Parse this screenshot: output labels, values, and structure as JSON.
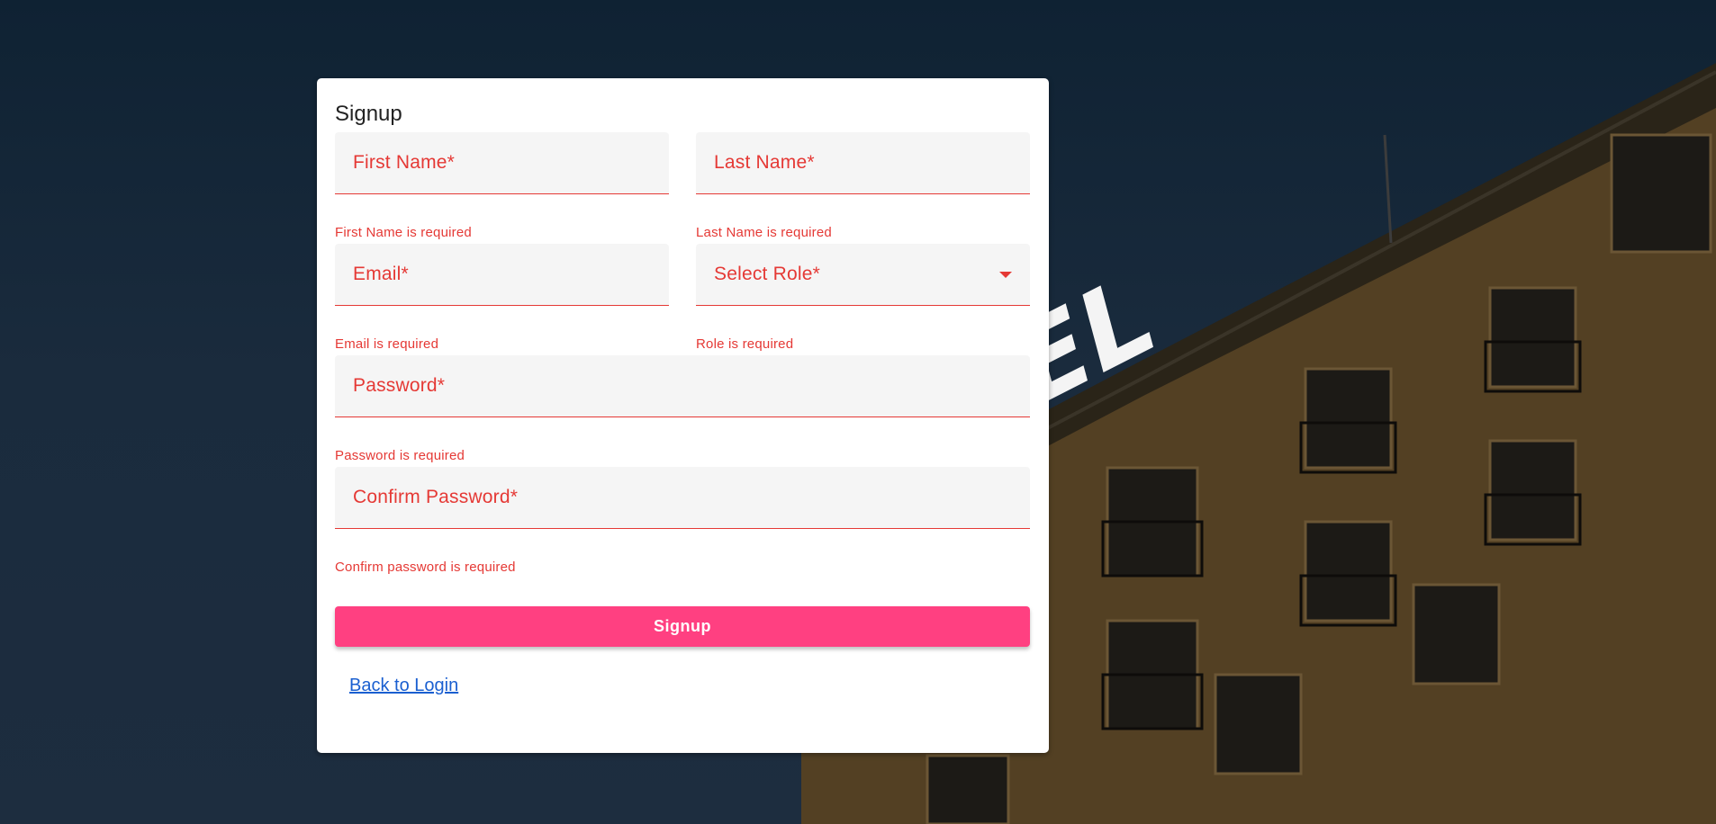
{
  "form": {
    "title": "Signup",
    "first_name": {
      "label": "First Name*",
      "error": "First Name is required"
    },
    "last_name": {
      "label": "Last Name*",
      "error": "Last Name is required"
    },
    "email": {
      "label": "Email*",
      "error": "Email is required"
    },
    "role": {
      "label": "Select Role*",
      "error": "Role is required",
      "icon": "dropdown-arrow-icon"
    },
    "password": {
      "label": "Password*",
      "error": "Password is required"
    },
    "confirm_password": {
      "label": "Confirm Password*",
      "error": "Confirm password is required"
    },
    "submit_label": "Signup",
    "back_link": "Back to Login"
  },
  "background": {
    "sign_text": "TEL"
  },
  "colors": {
    "error": "#e53935",
    "button": "#ff4081",
    "link": "#1a5fd0"
  }
}
